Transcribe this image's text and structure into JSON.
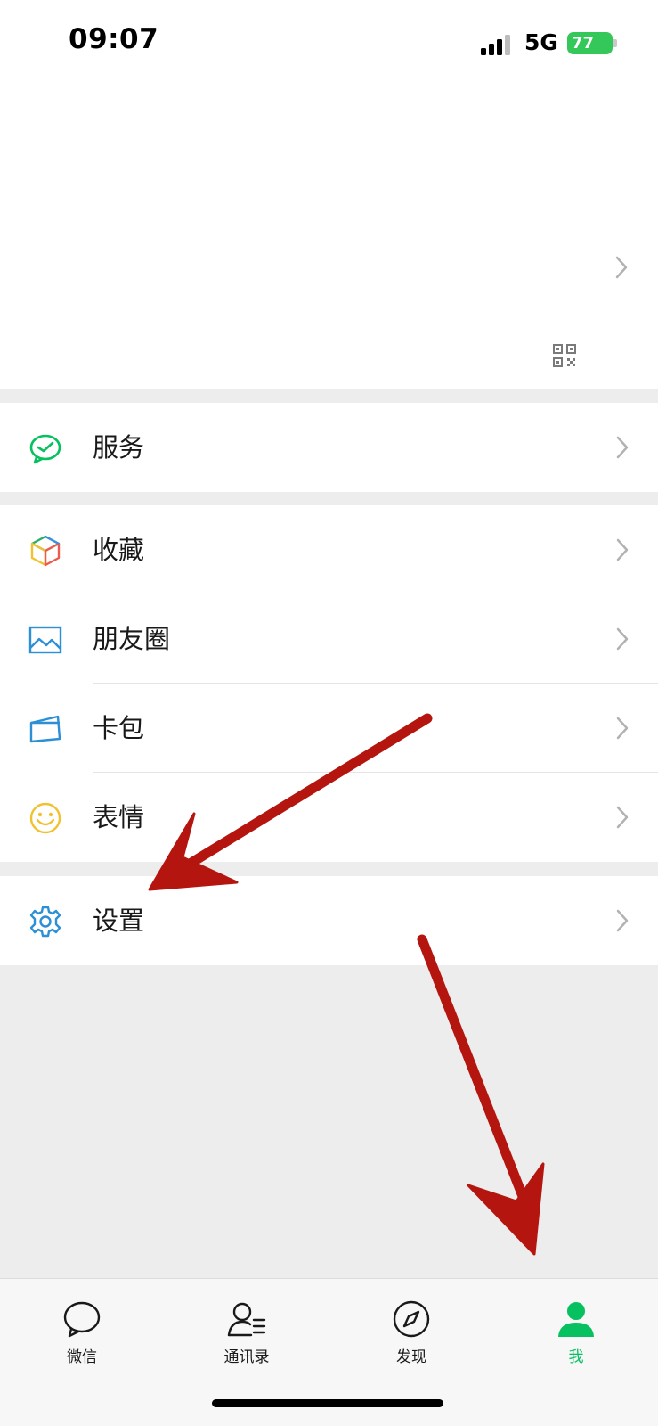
{
  "status_bar": {
    "time": "09:07",
    "network": "5G",
    "battery": "77"
  },
  "profile": {
    "qr_icon": "qr-code-icon",
    "chevron_icon": "chevron-right-icon"
  },
  "menu": {
    "services": {
      "label": "服务",
      "icon": "services-icon"
    },
    "favorites": {
      "label": "收藏",
      "icon": "favorites-cube-icon"
    },
    "moments": {
      "label": "朋友圈",
      "icon": "moments-picture-icon"
    },
    "cards": {
      "label": "卡包",
      "icon": "card-wallet-icon"
    },
    "stickers": {
      "label": "表情",
      "icon": "smiley-icon"
    },
    "settings": {
      "label": "设置",
      "icon": "gear-icon"
    }
  },
  "tabbar": {
    "tabs": [
      {
        "label": "微信",
        "icon": "chat-bubble-icon",
        "active": false
      },
      {
        "label": "通讯录",
        "icon": "contacts-icon",
        "active": false
      },
      {
        "label": "发现",
        "icon": "compass-icon",
        "active": false
      },
      {
        "label": "我",
        "icon": "person-icon",
        "active": true
      }
    ]
  },
  "colors": {
    "accent": "#07c160",
    "annotation_arrow": "#b5150f",
    "background": "#ededed"
  }
}
